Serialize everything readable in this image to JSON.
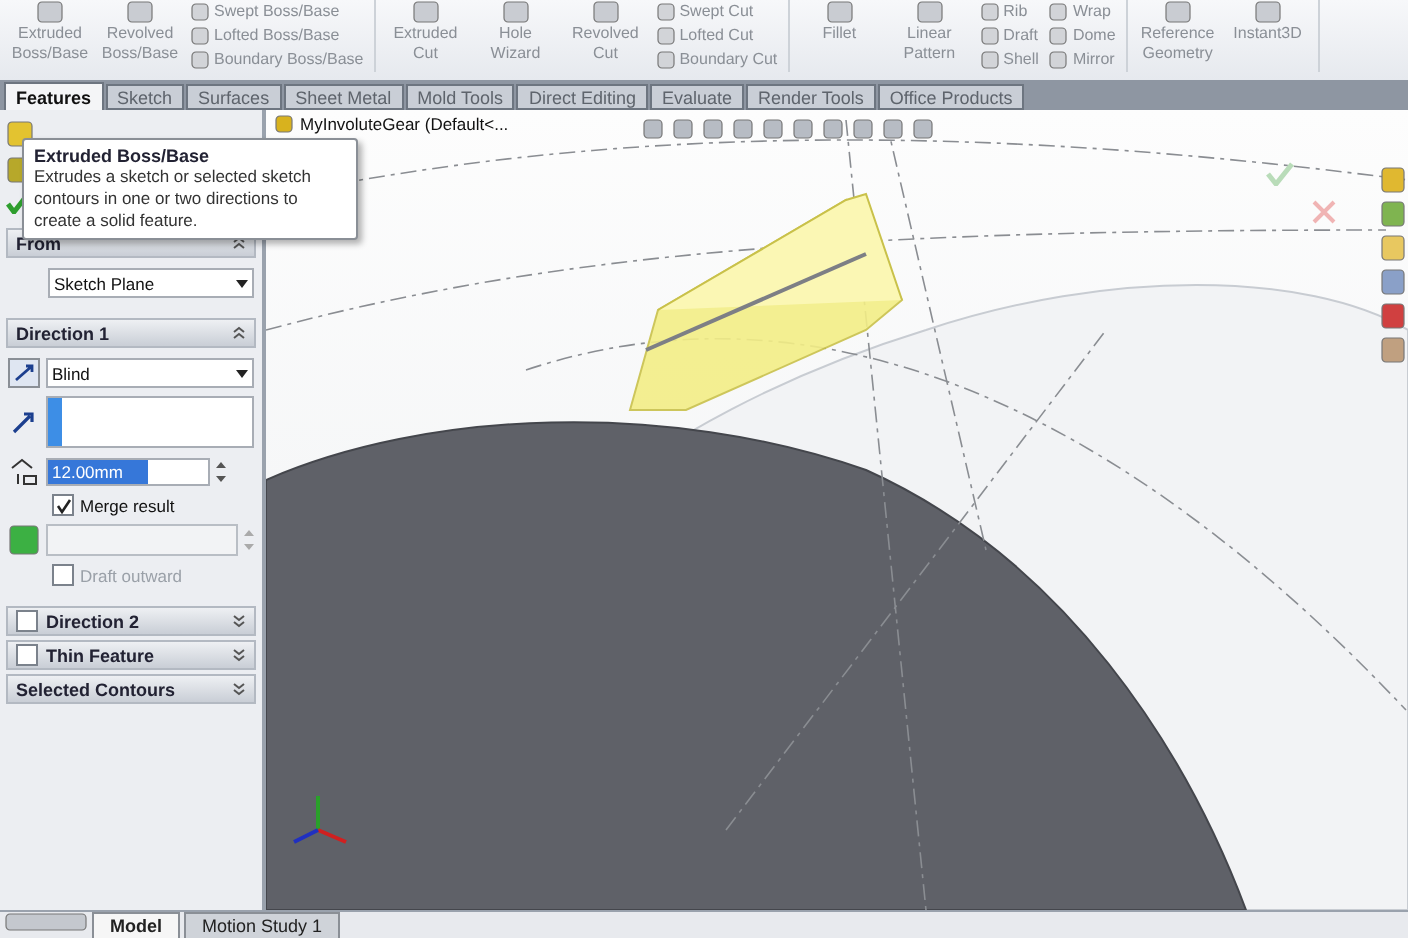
{
  "ribbon": {
    "sections": [
      [
        {
          "kind": "large",
          "label": "Extruded Boss/Base"
        },
        {
          "kind": "large",
          "label": "Revolved Boss/Base"
        },
        {
          "kind": "stack",
          "items": [
            "Swept Boss/Base",
            "Lofted Boss/Base",
            "Boundary Boss/Base"
          ]
        }
      ],
      [
        {
          "kind": "large",
          "label": "Extruded Cut"
        },
        {
          "kind": "large",
          "label": "Hole Wizard"
        },
        {
          "kind": "large",
          "label": "Revolved Cut"
        },
        {
          "kind": "stack",
          "items": [
            "Swept Cut",
            "Lofted Cut",
            "Boundary Cut"
          ]
        }
      ],
      [
        {
          "kind": "large",
          "label": "Fillet"
        },
        {
          "kind": "large",
          "label": "Linear Pattern"
        },
        {
          "kind": "stack",
          "items": [
            "Rib",
            "Draft",
            "Shell"
          ]
        },
        {
          "kind": "stack",
          "items": [
            "Wrap",
            "Dome",
            "Mirror"
          ]
        }
      ],
      [
        {
          "kind": "large",
          "label": "Reference Geometry"
        },
        {
          "kind": "large",
          "label": "Instant3D"
        }
      ]
    ]
  },
  "command_tabs": [
    {
      "label": "Features",
      "selected": true
    },
    {
      "label": "Sketch",
      "selected": false
    },
    {
      "label": "Surfaces",
      "selected": false
    },
    {
      "label": "Sheet Metal",
      "selected": false
    },
    {
      "label": "Mold Tools",
      "selected": false
    },
    {
      "label": "Direct Editing",
      "selected": false
    },
    {
      "label": "Evaluate",
      "selected": false
    },
    {
      "label": "Render Tools",
      "selected": false
    },
    {
      "label": "Office Products",
      "selected": false
    }
  ],
  "tooltip": {
    "title": "Extruded Boss/Base",
    "text": "Extrudes a sketch or selected sketch contours in one or two directions to create a solid feature."
  },
  "property_manager": {
    "sections": [
      {
        "kind": "from",
        "title": "From",
        "expanded": true,
        "start": "Sketch Plane"
      },
      {
        "kind": "direction",
        "title": "Direction 1",
        "expanded": true,
        "end_condition": "Blind",
        "depth": "12.00mm",
        "merge_result": {
          "label": "Merge result",
          "checked": true
        },
        "draft_outward": {
          "label": "Draft outward",
          "checked": false,
          "disabled": true
        }
      },
      {
        "kind": "optional",
        "title": "Direction 2",
        "expanded": false,
        "checked": false
      },
      {
        "kind": "optional",
        "title": "Thin Feature",
        "expanded": false,
        "checked": false
      },
      {
        "kind": "plain",
        "title": "Selected Contours",
        "expanded": false
      }
    ]
  },
  "feature_tree": {
    "label": "MyInvoluteGear  (Default<..."
  },
  "bottom_tabs": [
    {
      "label": "Model",
      "selected": true
    },
    {
      "label": "Motion Study 1",
      "selected": false
    }
  ]
}
